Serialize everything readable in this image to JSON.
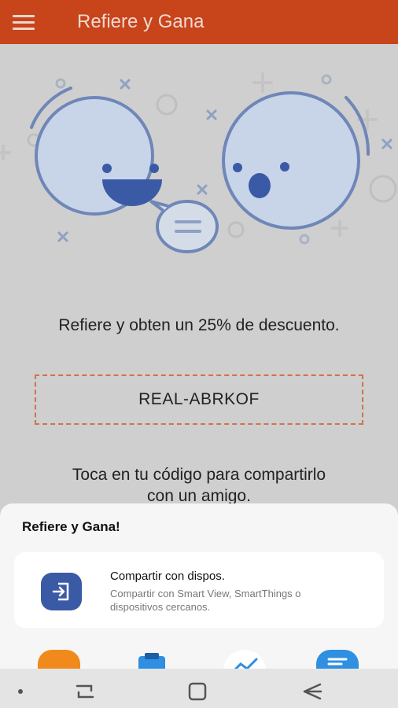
{
  "appbar": {
    "title": "Refiere y Gana",
    "menu_icon": "hamburger-menu-icon"
  },
  "main": {
    "illustration_icon": "two-smiley-faces-chat-illustration",
    "headline": "Refiere y obten un 25% de descuento.",
    "referral_code": "REAL-ABRKOF",
    "hint_line1": "Toca en tu código para compartirlo",
    "hint_line2": "con un amigo."
  },
  "share_sheet": {
    "title": "Refiere y Gana!",
    "option": {
      "title": "Compartir con dispos.",
      "subtitle": "Compartir con Smart View, SmartThings o dispositivos cercanos.",
      "icon": "share-to-device-icon"
    },
    "apps": [
      {
        "icon": "orange-app-icon",
        "color": "#f08a1c"
      },
      {
        "icon": "clipboard-app-icon",
        "color": "#2f8fe0"
      },
      {
        "icon": "chart-app-icon",
        "color": "#ffffff"
      },
      {
        "icon": "message-app-icon",
        "color": "#2f8fe0"
      }
    ]
  },
  "navbar": {
    "dot_icon": "nav-dot-icon",
    "recents_icon": "recents-icon",
    "home_icon": "home-icon",
    "back_icon": "back-arrow-icon"
  },
  "colors": {
    "appbar": "#c8441b",
    "accent_dashed": "#d0734c",
    "share_icon_bg": "#3b5aa6"
  }
}
